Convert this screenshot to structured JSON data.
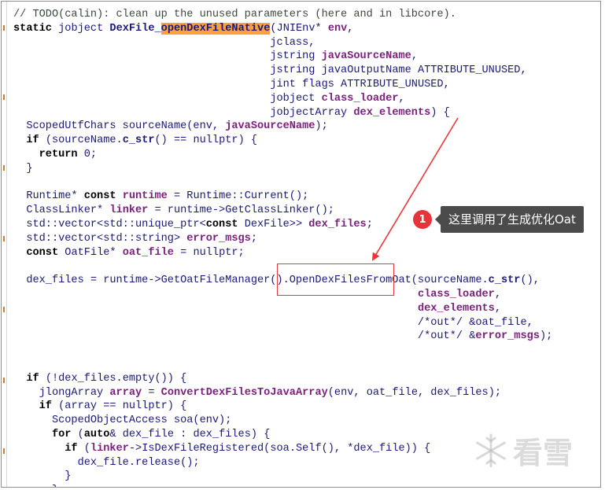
{
  "code_lines": [
    [
      [
        "cm",
        "// TODO(calin): clean up the unused parameters (here and in libcore).",
        false
      ]
    ],
    [
      [
        "kw",
        "static",
        false
      ],
      [
        "tx",
        " ",
        false
      ],
      [
        "ty",
        "jobject",
        false
      ],
      [
        "tx",
        " ",
        false
      ],
      [
        "fn",
        "DexFile_",
        false
      ],
      [
        "fn",
        "openDexFileNative",
        true
      ],
      [
        "tx",
        "(",
        false
      ],
      [
        "ty",
        "JNIEnv",
        false
      ],
      [
        "tx",
        "* ",
        false
      ],
      [
        "id",
        "env",
        false
      ],
      [
        "tx",
        ",",
        false
      ]
    ],
    [
      [
        "tx",
        "                                        jclass,",
        false
      ]
    ],
    [
      [
        "tx",
        "                                        ",
        false
      ],
      [
        "ty",
        "jstring",
        false
      ],
      [
        "tx",
        " ",
        false
      ],
      [
        "id",
        "javaSourceName",
        false
      ],
      [
        "tx",
        ",",
        false
      ]
    ],
    [
      [
        "tx",
        "                                        ",
        false
      ],
      [
        "ty",
        "jstring",
        false
      ],
      [
        "tx",
        " javaOutputName ATTRIBUTE_UNUSED,",
        false
      ]
    ],
    [
      [
        "tx",
        "                                        ",
        false
      ],
      [
        "ty",
        "jint",
        false
      ],
      [
        "tx",
        " flags ATTRIBUTE_UNUSED,",
        false
      ]
    ],
    [
      [
        "tx",
        "                                        ",
        false
      ],
      [
        "ty",
        "jobject",
        false
      ],
      [
        "tx",
        " ",
        false
      ],
      [
        "id",
        "class_loader",
        false
      ],
      [
        "tx",
        ",",
        false
      ]
    ],
    [
      [
        "tx",
        "                                        ",
        false
      ],
      [
        "ty",
        "jobjectArray",
        false
      ],
      [
        "tx",
        " ",
        false
      ],
      [
        "id",
        "dex_elements",
        false
      ],
      [
        "tx",
        ") {",
        false
      ]
    ],
    [
      [
        "tx",
        "  ScopedUtfChars sourceName(env, ",
        false
      ],
      [
        "id",
        "javaSourceName",
        false
      ],
      [
        "tx",
        ");",
        false
      ]
    ],
    [
      [
        "tx",
        "  ",
        false
      ],
      [
        "kw",
        "if",
        false
      ],
      [
        "tx",
        " (sourceName.",
        false
      ],
      [
        "fn",
        "c_str",
        false
      ],
      [
        "tx",
        "() == nullptr) {",
        false
      ]
    ],
    [
      [
        "tx",
        "    ",
        false
      ],
      [
        "kw",
        "return",
        false
      ],
      [
        "tx",
        " 0;",
        false
      ]
    ],
    [
      [
        "tx",
        "  }",
        false
      ]
    ],
    [
      [
        "tx",
        "",
        false
      ]
    ],
    [
      [
        "tx",
        "  Runtime* ",
        false
      ],
      [
        "kw",
        "const",
        false
      ],
      [
        "tx",
        " ",
        false
      ],
      [
        "id",
        "runtime",
        false
      ],
      [
        "tx",
        " = Runtime::Current();",
        false
      ]
    ],
    [
      [
        "tx",
        "  ClassLinker* ",
        false
      ],
      [
        "id",
        "linker",
        false
      ],
      [
        "tx",
        " = runtime->GetClassLinker();",
        false
      ]
    ],
    [
      [
        "tx",
        "  std::vector<std::unique_ptr<",
        false
      ],
      [
        "kw",
        "const",
        false
      ],
      [
        "tx",
        " DexFile>> ",
        false
      ],
      [
        "id",
        "dex_files",
        false
      ],
      [
        "tx",
        ";",
        false
      ]
    ],
    [
      [
        "tx",
        "  std::vector<std::string> ",
        false
      ],
      [
        "id",
        "error_msgs",
        false
      ],
      [
        "tx",
        ";",
        false
      ]
    ],
    [
      [
        "tx",
        "  ",
        false
      ],
      [
        "kw",
        "const",
        false
      ],
      [
        "tx",
        " OatFile* ",
        false
      ],
      [
        "id",
        "oat_file",
        false
      ],
      [
        "tx",
        " = nullptr;",
        false
      ]
    ],
    [
      [
        "tx",
        "",
        false
      ]
    ],
    [
      [
        "tx",
        "  dex_files = runtime->GetOatFileManager().OpenDexFilesFromOat(sourceName.",
        false
      ],
      [
        "fn",
        "c_str",
        false
      ],
      [
        "tx",
        "(),",
        false
      ]
    ],
    [
      [
        "tx",
        "                                                               ",
        false
      ],
      [
        "id",
        "class_loader",
        false
      ],
      [
        "tx",
        ",",
        false
      ]
    ],
    [
      [
        "tx",
        "                                                               ",
        false
      ],
      [
        "id",
        "dex_elements",
        false
      ],
      [
        "tx",
        ",",
        false
      ]
    ],
    [
      [
        "tx",
        "                                                               /*out*/ &oat_file,",
        false
      ]
    ],
    [
      [
        "tx",
        "                                                               /*out*/ &",
        false
      ],
      [
        "id",
        "error_msgs",
        false
      ],
      [
        "tx",
        ");",
        false
      ]
    ],
    [
      [
        "tx",
        "",
        false
      ]
    ],
    [
      [
        "tx",
        "",
        false
      ]
    ],
    [
      [
        "tx",
        "  ",
        false
      ],
      [
        "kw",
        "if",
        false
      ],
      [
        "tx",
        " (!dex_files.empty()) {",
        false
      ]
    ],
    [
      [
        "tx",
        "    jlongArray ",
        false
      ],
      [
        "id",
        "array",
        false
      ],
      [
        "tx",
        " = ",
        false
      ],
      [
        "id",
        "ConvertDexFilesToJavaArray",
        false
      ],
      [
        "tx",
        "(env, oat_file, dex_files);",
        false
      ]
    ],
    [
      [
        "tx",
        "    ",
        false
      ],
      [
        "kw",
        "if",
        false
      ],
      [
        "tx",
        " (array == nullptr) {",
        false
      ]
    ],
    [
      [
        "tx",
        "      ScopedObjectAccess soa(env);",
        false
      ]
    ],
    [
      [
        "tx",
        "      ",
        false
      ],
      [
        "kw",
        "for",
        false
      ],
      [
        "tx",
        " (",
        false
      ],
      [
        "kw",
        "auto",
        false
      ],
      [
        "tx",
        "& dex_file : dex_files) {",
        false
      ]
    ],
    [
      [
        "tx",
        "        ",
        false
      ],
      [
        "kw",
        "if",
        false
      ],
      [
        "tx",
        " (",
        false
      ],
      [
        "id",
        "linker",
        false
      ],
      [
        "tx",
        "->IsDexFileRegistered(soa.Self(), *dex_file)) {",
        false
      ]
    ],
    [
      [
        "tx",
        "          dex_file.release();",
        false
      ]
    ],
    [
      [
        "tx",
        "        }",
        false
      ]
    ],
    [
      [
        "tx",
        "      }",
        false
      ]
    ],
    [
      [
        "tx",
        "    }",
        false
      ]
    ]
  ],
  "annotation": {
    "number": "1",
    "label": "这里调用了生成优化Oat",
    "box_color": "#e8383a",
    "arrow_color": "#e8383a",
    "highlighted_call": "OpenDexFilesFromOat"
  },
  "colors": {
    "background": "#ffffff",
    "code_text": "#1a1a78",
    "keyword": "#000000",
    "identifier": "#7a1f7a",
    "highlight": "#ff9f3f",
    "badge": "#e5353b",
    "callout_bg": "#4b4b4b"
  },
  "watermark": {
    "text": "看雪",
    "icon": "snowflake-icon"
  }
}
